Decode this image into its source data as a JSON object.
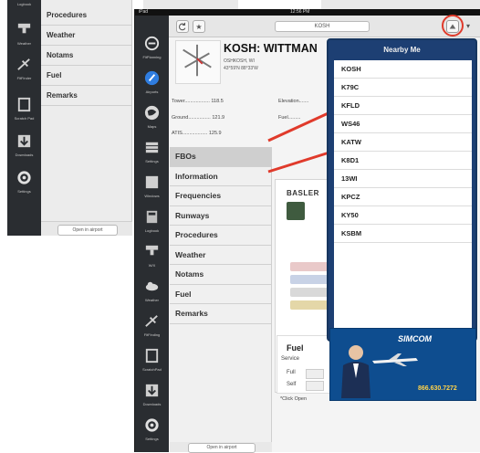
{
  "colors": {
    "accent_red": "#e03a2b",
    "popover_blue": "#1d3f73",
    "sidebar_dark": "#2a2d31"
  },
  "back": {
    "menu": [
      "Procedures",
      "Weather",
      "Notams",
      "Fuel",
      "Remarks"
    ],
    "sidebar": [
      {
        "icon": "airport-icon",
        "label": "Logbook"
      },
      {
        "icon": "weather-icon",
        "label": "Weather"
      },
      {
        "icon": "flight-plan-icon",
        "label": "FltFinder"
      },
      {
        "icon": "document-icon",
        "label": "Scratch Pad"
      },
      {
        "icon": "download-icon",
        "label": "Downloads"
      },
      {
        "icon": "gear-icon",
        "label": "Settings"
      }
    ],
    "open_button": "Open in airport"
  },
  "front": {
    "status": {
      "carrier": "iPad",
      "time": "12:56 PM"
    },
    "toolbar": {
      "field": "KOSH"
    },
    "sidebar": [
      {
        "icon": "flightplan-icon",
        "label": "FltPlanning"
      },
      {
        "icon": "airports-icon",
        "label": "Airports"
      },
      {
        "icon": "maps-icon",
        "label": "Maps"
      },
      {
        "icon": "charts-icon",
        "label": "Settings"
      },
      {
        "icon": "window-icon",
        "label": "Windows"
      },
      {
        "icon": "logbook-icon",
        "label": "Logbook"
      },
      {
        "icon": "weather-icon",
        "label": "W/X"
      },
      {
        "icon": "cloud-icon",
        "label": "Weather"
      },
      {
        "icon": "plane-icon",
        "label": "FltFinding"
      },
      {
        "icon": "scratchpad-icon",
        "label": "ScratchPad"
      },
      {
        "icon": "download-icon",
        "label": "Downloads"
      },
      {
        "icon": "gear-icon",
        "label": "Settings"
      }
    ],
    "airport": {
      "title": "KOSH: WITTMAN",
      "subtitle": "OSHKOSH, WI",
      "coords": "43°59'N  88°33'W"
    },
    "info": {
      "tower": "Tower.................. 118.5",
      "ground": "Ground................ 121.9",
      "atis": "ATIS.................. 125.9",
      "elevation": "Elevation.......",
      "fuel": "Fuel........."
    },
    "menu": [
      "FBOs",
      "Information",
      "Frequencies",
      "Runways",
      "Procedures",
      "Weather",
      "Notams",
      "Fuel",
      "Remarks"
    ],
    "fbo": {
      "title": "BASLER",
      "fuel_title": "Fuel",
      "fuel_rows": [
        "Service",
        "Full",
        "Self"
      ],
      "note": "*Click Open"
    },
    "open_button": "Open in airport",
    "popover": {
      "title": "Nearby Me",
      "items": [
        "KOSH",
        "K79C",
        "KFLD",
        "WS46",
        "KATW",
        "K8D1",
        "13WI",
        "KPCZ",
        "KY50",
        "KSBM"
      ]
    },
    "ad": {
      "brand": "SIMCOM",
      "phone": "866.630.7272"
    }
  }
}
